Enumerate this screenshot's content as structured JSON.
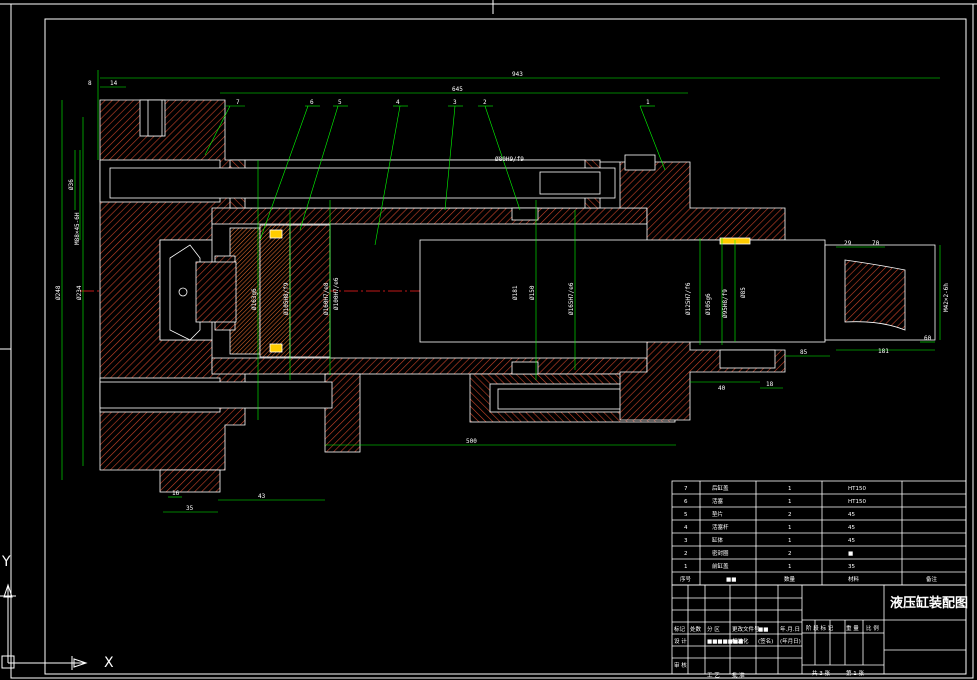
{
  "drawing": {
    "title": "液压缸装配图",
    "colors": {
      "background": "#000000",
      "frame": "#ffffff",
      "part_outline": "#ffffff",
      "hatch": "#c8442a",
      "dimension": "#00ff00",
      "centerline": "#ff2020",
      "leader": "#00ff00",
      "seal": "#ffcc00"
    }
  },
  "dimensions": {
    "overall_length": "943",
    "body_length": "645",
    "stroke": "500",
    "d_8": "8",
    "d_14": "14",
    "d_38": "38",
    "d_16": "16",
    "d_35": "35",
    "d_43": "43",
    "d_29": "29",
    "d_70": "70",
    "d_85": "85",
    "d_181": "181",
    "d_60": "60",
    "d_40": "40",
    "d_18": "18",
    "v_36": "Ø36",
    "v_m88": "M88×45-6H",
    "v_248": "Ø248",
    "v_234": "Ø234",
    "v_163": "Ø163g6",
    "v_105": "Ø105H8/f9",
    "v_160": "Ø160H7/e8",
    "v_100": "Ø100H7/e6",
    "v_181": "Ø181",
    "v_150": "Ø150",
    "v_165": "Ø165H7/e6",
    "v_125": "Ø125H7/f6",
    "v_105g": "Ø105g6",
    "v_95": "Ø95H8/f9",
    "v_85": "Ø85",
    "v_m42": "M42×2-6h",
    "fit_ann": "Ø80H9/f9"
  },
  "balloons": [
    "1",
    "2",
    "3",
    "4",
    "5",
    "6",
    "7"
  ],
  "parts_list": {
    "rows": [
      {
        "no": "7",
        "name": "后缸盖",
        "qty": "1",
        "material": "HT150",
        "note": ""
      },
      {
        "no": "6",
        "name": "活塞",
        "qty": "1",
        "material": "HT150",
        "note": ""
      },
      {
        "no": "5",
        "name": "垫片",
        "qty": "2",
        "material": "45",
        "note": ""
      },
      {
        "no": "4",
        "name": "活塞杆",
        "qty": "1",
        "material": "45",
        "note": ""
      },
      {
        "no": "3",
        "name": "缸体",
        "qty": "1",
        "material": "45",
        "note": ""
      },
      {
        "no": "2",
        "name": "密封圈",
        "qty": "2",
        "material": "■",
        "note": ""
      },
      {
        "no": "1",
        "name": "前缸盖",
        "qty": "1",
        "material": "35",
        "note": ""
      }
    ],
    "header": {
      "no": "序号",
      "name": "■■",
      "qty": "数量",
      "material": "材料",
      "note": "备注"
    }
  },
  "title_block": {
    "row1": [
      "标记",
      "处数",
      "分 区",
      "更改文件号",
      "■■",
      "年.月.日"
    ],
    "row2": [
      "设 计",
      "■■■■■■■",
      "标准化",
      "(签名)",
      "(年月日)"
    ],
    "row3": [
      "审 核"
    ],
    "row4": [
      "工 艺",
      "批 准"
    ],
    "stage": [
      "阶 段 标 记",
      "重 量",
      "比 例"
    ],
    "sheet": [
      "共 3 张",
      "第 1 张"
    ]
  },
  "axes": {
    "x": "X",
    "y": "Y"
  }
}
